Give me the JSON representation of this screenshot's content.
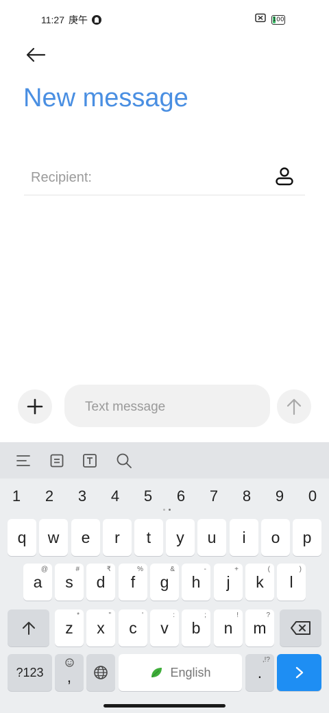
{
  "status_bar": {
    "time": "11:27",
    "chinese_time": "庚午",
    "battery_level": "100",
    "battery_color": "#3ec46d"
  },
  "header": {
    "back_icon": "arrow-left-icon",
    "title": "New message",
    "title_color": "#4a8fe2"
  },
  "recipient": {
    "placeholder": "Recipient:",
    "value": "",
    "contact_icon": "person-icon"
  },
  "compose": {
    "attach_icon": "plus-icon",
    "placeholder": "Text message",
    "value": "",
    "send_icon": "arrow-up-icon"
  },
  "keyboard": {
    "toolbar_icons": [
      "menu-lines-icon",
      "clipboard-icon",
      "text-t-icon",
      "search-icon"
    ],
    "numbers": [
      "1",
      "2",
      "3",
      "4",
      "5",
      "6",
      "7",
      "8",
      "9",
      "0"
    ],
    "row1": [
      {
        "key": "q",
        "hint": ""
      },
      {
        "key": "w",
        "hint": ""
      },
      {
        "key": "e",
        "hint": ""
      },
      {
        "key": "r",
        "hint": ""
      },
      {
        "key": "t",
        "hint": ""
      },
      {
        "key": "y",
        "hint": ""
      },
      {
        "key": "u",
        "hint": ""
      },
      {
        "key": "i",
        "hint": ""
      },
      {
        "key": "o",
        "hint": ""
      },
      {
        "key": "p",
        "hint": ""
      }
    ],
    "row2": [
      {
        "key": "a",
        "hint": "@"
      },
      {
        "key": "s",
        "hint": "#"
      },
      {
        "key": "d",
        "hint": "₹"
      },
      {
        "key": "f",
        "hint": "%"
      },
      {
        "key": "g",
        "hint": "&"
      },
      {
        "key": "h",
        "hint": "-"
      },
      {
        "key": "j",
        "hint": "+"
      },
      {
        "key": "k",
        "hint": "("
      },
      {
        "key": "l",
        "hint": ")"
      }
    ],
    "row3": [
      {
        "key": "z",
        "hint": "*"
      },
      {
        "key": "x",
        "hint": "\""
      },
      {
        "key": "c",
        "hint": "'"
      },
      {
        "key": "v",
        "hint": ":"
      },
      {
        "key": "b",
        "hint": ";"
      },
      {
        "key": "n",
        "hint": "!"
      },
      {
        "key": "m",
        "hint": "?"
      }
    ],
    "symbols_label": "?123",
    "comma_label": ",",
    "space_label": "English",
    "period_label": ".",
    "period_hint": ",!?",
    "accent_color": "#1e8ef3"
  }
}
